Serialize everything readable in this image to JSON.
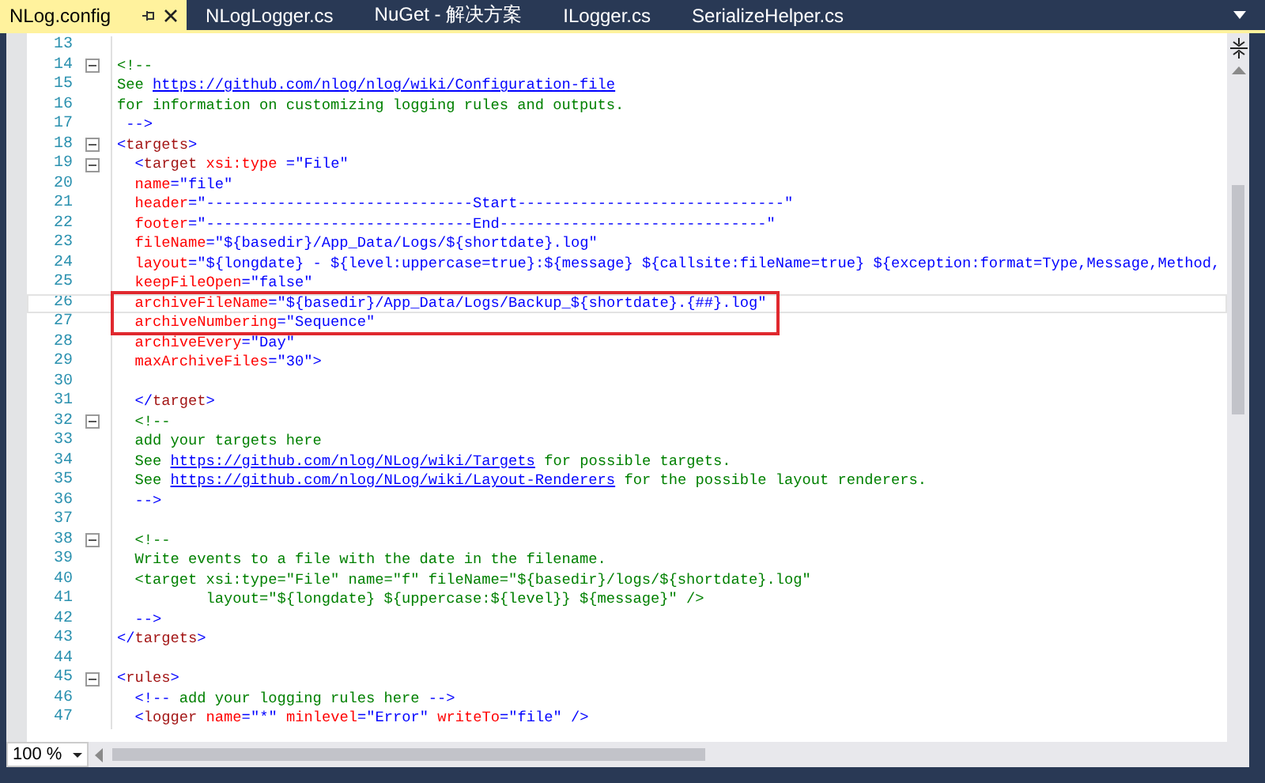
{
  "tabs": [
    {
      "label": "NLog.config",
      "selected": true
    },
    {
      "label": "NLogLogger.cs",
      "selected": false
    },
    {
      "label": "NuGet - 解决方案",
      "selected": false
    },
    {
      "label": "ILogger.cs",
      "selected": false
    },
    {
      "label": "SerializeHelper.cs",
      "selected": false
    }
  ],
  "editor": {
    "lines": [
      {
        "number": "13",
        "collapsible": false,
        "current": false,
        "boxed": false
      },
      {
        "number": "14",
        "collapsible": true,
        "current": false,
        "boxed": false,
        "tokens": [
          {
            "kind": "comment",
            "text": "<!--"
          }
        ]
      },
      {
        "number": "15",
        "collapsible": false,
        "current": false,
        "boxed": false,
        "tokens": [
          {
            "kind": "comment",
            "text": "See "
          },
          {
            "kind": "link",
            "text": "https://github.com/nlog/nlog/wiki/Configuration-file"
          }
        ]
      },
      {
        "number": "16",
        "collapsible": false,
        "current": false,
        "boxed": false,
        "tokens": [
          {
            "kind": "comment",
            "text": "for information on customizing logging rules and outputs."
          }
        ]
      },
      {
        "number": "17",
        "collapsible": false,
        "current": false,
        "boxed": false,
        "tokens": [
          {
            "kind": "punct",
            "text": " -->"
          }
        ]
      },
      {
        "number": "18",
        "collapsible": true,
        "current": false,
        "boxed": false,
        "tokens": [
          {
            "kind": "punct",
            "text": "<"
          },
          {
            "kind": "element",
            "text": "targets"
          },
          {
            "kind": "punct",
            "text": ">"
          }
        ]
      },
      {
        "number": "19",
        "collapsible": true,
        "current": false,
        "boxed": false,
        "tokens": [
          {
            "kind": "punct",
            "text": "  <"
          },
          {
            "kind": "element",
            "text": "target"
          },
          {
            "kind": "attr",
            "text": " xsi:type"
          },
          {
            "kind": "punct",
            "text": " ="
          },
          {
            "kind": "value",
            "text": "\"File\""
          }
        ]
      },
      {
        "number": "20",
        "collapsible": false,
        "current": false,
        "boxed": false,
        "tokens": [
          {
            "kind": "attr",
            "text": "  name"
          },
          {
            "kind": "punct",
            "text": "="
          },
          {
            "kind": "value",
            "text": "\"file\""
          }
        ]
      },
      {
        "number": "21",
        "collapsible": false,
        "current": false,
        "boxed": false,
        "tokens": [
          {
            "kind": "attr",
            "text": "  header"
          },
          {
            "kind": "punct",
            "text": "="
          },
          {
            "kind": "value",
            "text": "\"------------------------------Start------------------------------\""
          }
        ]
      },
      {
        "number": "22",
        "collapsible": false,
        "current": false,
        "boxed": false,
        "tokens": [
          {
            "kind": "attr",
            "text": "  footer"
          },
          {
            "kind": "punct",
            "text": "="
          },
          {
            "kind": "value",
            "text": "\"------------------------------End------------------------------\""
          }
        ]
      },
      {
        "number": "23",
        "collapsible": false,
        "current": false,
        "boxed": false,
        "tokens": [
          {
            "kind": "attr",
            "text": "  fileName"
          },
          {
            "kind": "punct",
            "text": "="
          },
          {
            "kind": "value",
            "text": "\"${basedir}/App_Data/Logs/${shortdate}.log\""
          }
        ]
      },
      {
        "number": "24",
        "collapsible": false,
        "current": false,
        "boxed": false,
        "tokens": [
          {
            "kind": "attr",
            "text": "  layout"
          },
          {
            "kind": "punct",
            "text": "="
          },
          {
            "kind": "value",
            "text": "\"${longdate} - ${level:uppercase=true}:${message} ${callsite:fileName=true} ${exception:format=Type,Message,Method,"
          }
        ]
      },
      {
        "number": "25",
        "collapsible": false,
        "current": false,
        "boxed": false,
        "tokens": [
          {
            "kind": "attr",
            "text": "  keepFileOpen"
          },
          {
            "kind": "punct",
            "text": "="
          },
          {
            "kind": "value",
            "text": "\"false\""
          }
        ]
      },
      {
        "number": "26",
        "collapsible": false,
        "current": true,
        "boxed": true,
        "tokens": [
          {
            "kind": "attr",
            "text": "  archiveFileName"
          },
          {
            "kind": "punct",
            "text": "="
          },
          {
            "kind": "value",
            "text": "\"${basedir}/App_Data/Logs/Backup_${shortdate}.{##}.log\""
          }
        ]
      },
      {
        "number": "27",
        "collapsible": false,
        "current": false,
        "boxed": true,
        "tokens": [
          {
            "kind": "attr",
            "text": "  archiveNumbering"
          },
          {
            "kind": "punct",
            "text": "="
          },
          {
            "kind": "value",
            "text": "\"Sequence\""
          }
        ]
      },
      {
        "number": "28",
        "collapsible": false,
        "current": false,
        "boxed": false,
        "tokens": [
          {
            "kind": "attr",
            "text": "  archiveEvery"
          },
          {
            "kind": "punct",
            "text": "="
          },
          {
            "kind": "value",
            "text": "\"Day\""
          }
        ]
      },
      {
        "number": "29",
        "collapsible": false,
        "current": false,
        "boxed": false,
        "tokens": [
          {
            "kind": "attr",
            "text": "  maxArchiveFiles"
          },
          {
            "kind": "punct",
            "text": "="
          },
          {
            "kind": "value",
            "text": "\"30\""
          },
          {
            "kind": "punct",
            "text": ">"
          }
        ]
      },
      {
        "number": "30",
        "collapsible": false,
        "current": false,
        "boxed": false
      },
      {
        "number": "31",
        "collapsible": false,
        "current": false,
        "boxed": false,
        "tokens": [
          {
            "kind": "punct",
            "text": "  </"
          },
          {
            "kind": "element",
            "text": "target"
          },
          {
            "kind": "punct",
            "text": ">"
          }
        ]
      },
      {
        "number": "32",
        "collapsible": true,
        "current": false,
        "boxed": false,
        "tokens": [
          {
            "kind": "comment",
            "text": "  <!--"
          }
        ]
      },
      {
        "number": "33",
        "collapsible": false,
        "current": false,
        "boxed": false,
        "tokens": [
          {
            "kind": "comment",
            "text": "  add your targets here"
          }
        ]
      },
      {
        "number": "34",
        "collapsible": false,
        "current": false,
        "boxed": false,
        "tokens": [
          {
            "kind": "comment",
            "text": "  See "
          },
          {
            "kind": "link",
            "text": "https://github.com/nlog/NLog/wiki/Targets"
          },
          {
            "kind": "comment",
            "text": " for possible targets."
          }
        ]
      },
      {
        "number": "35",
        "collapsible": false,
        "current": false,
        "boxed": false,
        "tokens": [
          {
            "kind": "comment",
            "text": "  See "
          },
          {
            "kind": "link",
            "text": "https://github.com/nlog/NLog/wiki/Layout-Renderers"
          },
          {
            "kind": "comment",
            "text": " for the possible layout renderers."
          }
        ]
      },
      {
        "number": "36",
        "collapsible": false,
        "current": false,
        "boxed": false,
        "tokens": [
          {
            "kind": "punct",
            "text": "  -->"
          }
        ]
      },
      {
        "number": "37",
        "collapsible": false,
        "current": false,
        "boxed": false
      },
      {
        "number": "38",
        "collapsible": true,
        "current": false,
        "boxed": false,
        "tokens": [
          {
            "kind": "comment",
            "text": "  <!--"
          }
        ]
      },
      {
        "number": "39",
        "collapsible": false,
        "current": false,
        "boxed": false,
        "tokens": [
          {
            "kind": "comment",
            "text": "  Write events to a file with the date in the filename."
          }
        ]
      },
      {
        "number": "40",
        "collapsible": false,
        "current": false,
        "boxed": false,
        "tokens": [
          {
            "kind": "comment",
            "text": "  <target xsi:type=\"File\" name=\"f\" fileName=\"${basedir}/logs/${shortdate}.log\""
          }
        ]
      },
      {
        "number": "41",
        "collapsible": false,
        "current": false,
        "boxed": false,
        "tokens": [
          {
            "kind": "comment",
            "text": "          layout=\"${longdate} ${uppercase:${level}} ${message}\" />"
          }
        ]
      },
      {
        "number": "42",
        "collapsible": false,
        "current": false,
        "boxed": false,
        "tokens": [
          {
            "kind": "punct",
            "text": "  -->"
          }
        ]
      },
      {
        "number": "43",
        "collapsible": false,
        "current": false,
        "boxed": false,
        "tokens": [
          {
            "kind": "punct",
            "text": "</"
          },
          {
            "kind": "element",
            "text": "targets"
          },
          {
            "kind": "punct",
            "text": ">"
          }
        ]
      },
      {
        "number": "44",
        "collapsible": false,
        "current": false,
        "boxed": false
      },
      {
        "number": "45",
        "collapsible": true,
        "current": false,
        "boxed": false,
        "tokens": [
          {
            "kind": "punct",
            "text": "<"
          },
          {
            "kind": "element",
            "text": "rules"
          },
          {
            "kind": "punct",
            "text": ">"
          }
        ]
      },
      {
        "number": "46",
        "collapsible": false,
        "current": false,
        "boxed": false,
        "tokens": [
          {
            "kind": "punct",
            "text": "  <!--"
          },
          {
            "kind": "comment",
            "text": " add your logging rules here "
          },
          {
            "kind": "punct",
            "text": "-->"
          }
        ]
      },
      {
        "number": "47",
        "collapsible": false,
        "current": false,
        "boxed": false,
        "tokens": [
          {
            "kind": "punct",
            "text": "  <"
          },
          {
            "kind": "element",
            "text": "logger"
          },
          {
            "kind": "attr",
            "text": " name"
          },
          {
            "kind": "punct",
            "text": "="
          },
          {
            "kind": "value",
            "text": "\"*\""
          },
          {
            "kind": "attr",
            "text": " minlevel"
          },
          {
            "kind": "punct",
            "text": "="
          },
          {
            "kind": "value",
            "text": "\"Error\""
          },
          {
            "kind": "attr",
            "text": " writeTo"
          },
          {
            "kind": "punct",
            "text": "="
          },
          {
            "kind": "value",
            "text": "\"file\""
          },
          {
            "kind": "punct",
            "text": " />"
          }
        ]
      }
    ]
  },
  "zoom": {
    "value": "100 %"
  }
}
